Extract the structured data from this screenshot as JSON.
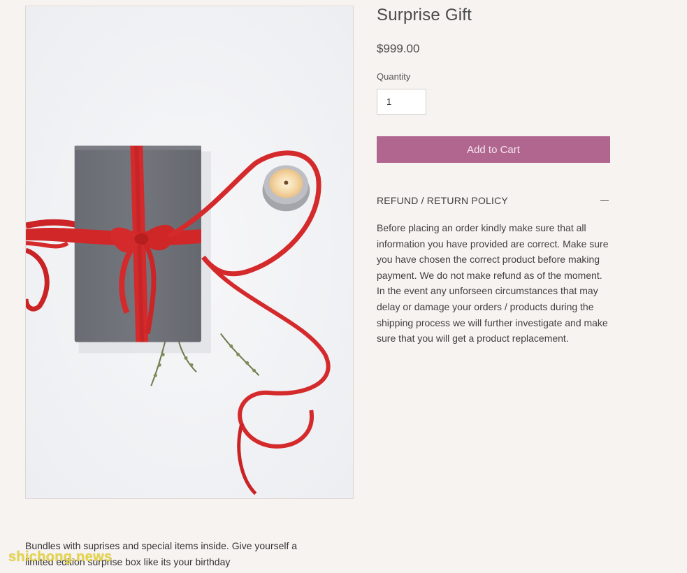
{
  "product": {
    "title": "Surprise Gift",
    "price": "$999.00",
    "quantity_label": "Quantity",
    "quantity_value": "1",
    "add_to_cart_label": "Add to Cart"
  },
  "policy": {
    "title": "REFUND / RETURN POLICY",
    "toggle_icon": "minus-icon",
    "paragraph_1": "Before placing an order kindly make sure that all information you have provided are correct. Make sure you have chosen the correct product before making payment. We do not make refund as of the moment.",
    "paragraph_2": "In the event any unforseen circumstances that may delay or damage your orders / products during the shipping process we will further investigate and make sure that you will get a product replacement."
  },
  "description": "Bundles with suprises and special items inside. Give yourself a limited edition surprise box like its your birthday",
  "watermark": "shichong.news",
  "colors": {
    "accent": "#b0668f",
    "background": "#f7f3f1",
    "ribbon": "#d42a2c",
    "box": "#6f7178"
  }
}
